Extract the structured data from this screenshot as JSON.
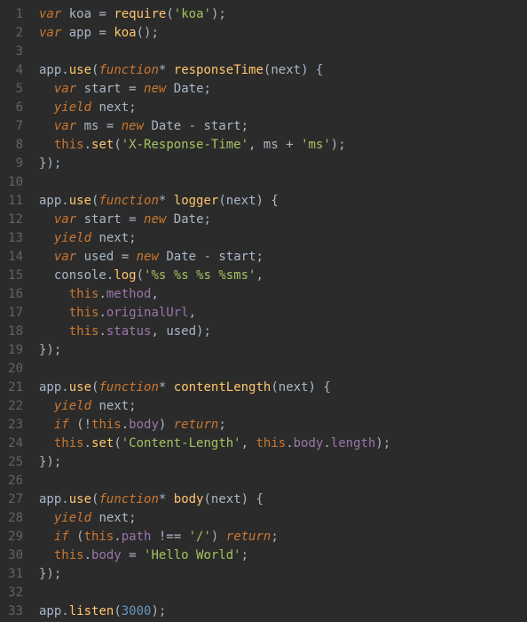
{
  "editor": {
    "language": "javascript",
    "theme": "darcula",
    "lines": [
      {
        "n": 1,
        "tokens": [
          [
            "kw",
            "var"
          ],
          [
            "op",
            " "
          ],
          [
            "id",
            "koa"
          ],
          [
            "op",
            " = "
          ],
          [
            "fn",
            "require"
          ],
          [
            "op",
            "("
          ],
          [
            "str",
            "'koa'"
          ],
          [
            "op",
            ");"
          ]
        ]
      },
      {
        "n": 2,
        "tokens": [
          [
            "kw",
            "var"
          ],
          [
            "op",
            " "
          ],
          [
            "id",
            "app"
          ],
          [
            "op",
            " = "
          ],
          [
            "fn",
            "koa"
          ],
          [
            "op",
            "();"
          ]
        ]
      },
      {
        "n": 3,
        "tokens": []
      },
      {
        "n": 4,
        "tokens": [
          [
            "id",
            "app"
          ],
          [
            "op",
            "."
          ],
          [
            "fn",
            "use"
          ],
          [
            "op",
            "("
          ],
          [
            "kw",
            "function"
          ],
          [
            "op",
            "* "
          ],
          [
            "name",
            "responseTime"
          ],
          [
            "op",
            "("
          ],
          [
            "param",
            "next"
          ],
          [
            "op",
            ") {"
          ]
        ]
      },
      {
        "n": 5,
        "tokens": [
          [
            "op",
            "  "
          ],
          [
            "kw",
            "var"
          ],
          [
            "op",
            " "
          ],
          [
            "id",
            "start"
          ],
          [
            "op",
            " = "
          ],
          [
            "kw",
            "new"
          ],
          [
            "op",
            " "
          ],
          [
            "type",
            "Date"
          ],
          [
            "op",
            ";"
          ]
        ]
      },
      {
        "n": 6,
        "tokens": [
          [
            "op",
            "  "
          ],
          [
            "kw",
            "yield"
          ],
          [
            "op",
            " "
          ],
          [
            "id",
            "next"
          ],
          [
            "op",
            ";"
          ]
        ]
      },
      {
        "n": 7,
        "tokens": [
          [
            "op",
            "  "
          ],
          [
            "kw",
            "var"
          ],
          [
            "op",
            " "
          ],
          [
            "id",
            "ms"
          ],
          [
            "op",
            " = "
          ],
          [
            "kw",
            "new"
          ],
          [
            "op",
            " "
          ],
          [
            "type",
            "Date"
          ],
          [
            "op",
            " - "
          ],
          [
            "id",
            "start"
          ],
          [
            "op",
            ";"
          ]
        ]
      },
      {
        "n": 8,
        "tokens": [
          [
            "op",
            "  "
          ],
          [
            "this",
            "this"
          ],
          [
            "op",
            "."
          ],
          [
            "fn",
            "set"
          ],
          [
            "op",
            "("
          ],
          [
            "str",
            "'X-Response-Time'"
          ],
          [
            "op",
            ", "
          ],
          [
            "id",
            "ms"
          ],
          [
            "op",
            " + "
          ],
          [
            "str",
            "'ms'"
          ],
          [
            "op",
            ");"
          ]
        ]
      },
      {
        "n": 9,
        "tokens": [
          [
            "op",
            "});"
          ]
        ]
      },
      {
        "n": 10,
        "tokens": []
      },
      {
        "n": 11,
        "tokens": [
          [
            "id",
            "app"
          ],
          [
            "op",
            "."
          ],
          [
            "fn",
            "use"
          ],
          [
            "op",
            "("
          ],
          [
            "kw",
            "function"
          ],
          [
            "op",
            "* "
          ],
          [
            "name",
            "logger"
          ],
          [
            "op",
            "("
          ],
          [
            "param",
            "next"
          ],
          [
            "op",
            ") {"
          ]
        ]
      },
      {
        "n": 12,
        "tokens": [
          [
            "op",
            "  "
          ],
          [
            "kw",
            "var"
          ],
          [
            "op",
            " "
          ],
          [
            "id",
            "start"
          ],
          [
            "op",
            " = "
          ],
          [
            "kw",
            "new"
          ],
          [
            "op",
            " "
          ],
          [
            "type",
            "Date"
          ],
          [
            "op",
            ";"
          ]
        ]
      },
      {
        "n": 13,
        "tokens": [
          [
            "op",
            "  "
          ],
          [
            "kw",
            "yield"
          ],
          [
            "op",
            " "
          ],
          [
            "id",
            "next"
          ],
          [
            "op",
            ";"
          ]
        ]
      },
      {
        "n": 14,
        "tokens": [
          [
            "op",
            "  "
          ],
          [
            "kw",
            "var"
          ],
          [
            "op",
            " "
          ],
          [
            "id",
            "used"
          ],
          [
            "op",
            " = "
          ],
          [
            "kw",
            "new"
          ],
          [
            "op",
            " "
          ],
          [
            "type",
            "Date"
          ],
          [
            "op",
            " - "
          ],
          [
            "id",
            "start"
          ],
          [
            "op",
            ";"
          ]
        ]
      },
      {
        "n": 15,
        "tokens": [
          [
            "op",
            "  "
          ],
          [
            "id",
            "console"
          ],
          [
            "op",
            "."
          ],
          [
            "fn",
            "log"
          ],
          [
            "op",
            "("
          ],
          [
            "str",
            "'%s %s %s %sms'"
          ],
          [
            "op",
            ","
          ]
        ]
      },
      {
        "n": 16,
        "tokens": [
          [
            "op",
            "    "
          ],
          [
            "this",
            "this"
          ],
          [
            "op",
            "."
          ],
          [
            "prop",
            "method"
          ],
          [
            "op",
            ","
          ]
        ]
      },
      {
        "n": 17,
        "tokens": [
          [
            "op",
            "    "
          ],
          [
            "this",
            "this"
          ],
          [
            "op",
            "."
          ],
          [
            "prop",
            "originalUrl"
          ],
          [
            "op",
            ","
          ]
        ]
      },
      {
        "n": 18,
        "tokens": [
          [
            "op",
            "    "
          ],
          [
            "this",
            "this"
          ],
          [
            "op",
            "."
          ],
          [
            "prop",
            "status"
          ],
          [
            "op",
            ", "
          ],
          [
            "id",
            "used"
          ],
          [
            "op",
            ");"
          ]
        ]
      },
      {
        "n": 19,
        "tokens": [
          [
            "op",
            "});"
          ]
        ]
      },
      {
        "n": 20,
        "tokens": []
      },
      {
        "n": 21,
        "tokens": [
          [
            "id",
            "app"
          ],
          [
            "op",
            "."
          ],
          [
            "fn",
            "use"
          ],
          [
            "op",
            "("
          ],
          [
            "kw",
            "function"
          ],
          [
            "op",
            "* "
          ],
          [
            "name",
            "contentLength"
          ],
          [
            "op",
            "("
          ],
          [
            "param",
            "next"
          ],
          [
            "op",
            ") {"
          ]
        ]
      },
      {
        "n": 22,
        "tokens": [
          [
            "op",
            "  "
          ],
          [
            "kw",
            "yield"
          ],
          [
            "op",
            " "
          ],
          [
            "id",
            "next"
          ],
          [
            "op",
            ";"
          ]
        ]
      },
      {
        "n": 23,
        "tokens": [
          [
            "op",
            "  "
          ],
          [
            "kw",
            "if"
          ],
          [
            "op",
            " (!"
          ],
          [
            "this",
            "this"
          ],
          [
            "op",
            "."
          ],
          [
            "prop",
            "body"
          ],
          [
            "op",
            ") "
          ],
          [
            "kw",
            "return"
          ],
          [
            "op",
            ";"
          ]
        ]
      },
      {
        "n": 24,
        "tokens": [
          [
            "op",
            "  "
          ],
          [
            "this",
            "this"
          ],
          [
            "op",
            "."
          ],
          [
            "fn",
            "set"
          ],
          [
            "op",
            "("
          ],
          [
            "str",
            "'Content-Length'"
          ],
          [
            "op",
            ", "
          ],
          [
            "this",
            "this"
          ],
          [
            "op",
            "."
          ],
          [
            "prop",
            "body"
          ],
          [
            "op",
            "."
          ],
          [
            "prop",
            "length"
          ],
          [
            "op",
            ");"
          ]
        ]
      },
      {
        "n": 25,
        "tokens": [
          [
            "op",
            "});"
          ]
        ]
      },
      {
        "n": 26,
        "tokens": []
      },
      {
        "n": 27,
        "tokens": [
          [
            "id",
            "app"
          ],
          [
            "op",
            "."
          ],
          [
            "fn",
            "use"
          ],
          [
            "op",
            "("
          ],
          [
            "kw",
            "function"
          ],
          [
            "op",
            "* "
          ],
          [
            "name",
            "body"
          ],
          [
            "op",
            "("
          ],
          [
            "param",
            "next"
          ],
          [
            "op",
            ") {"
          ]
        ]
      },
      {
        "n": 28,
        "tokens": [
          [
            "op",
            "  "
          ],
          [
            "kw",
            "yield"
          ],
          [
            "op",
            " "
          ],
          [
            "id",
            "next"
          ],
          [
            "op",
            ";"
          ]
        ]
      },
      {
        "n": 29,
        "tokens": [
          [
            "op",
            "  "
          ],
          [
            "kw",
            "if"
          ],
          [
            "op",
            " ("
          ],
          [
            "this",
            "this"
          ],
          [
            "op",
            "."
          ],
          [
            "prop",
            "path"
          ],
          [
            "op",
            " !== "
          ],
          [
            "str",
            "'/'"
          ],
          [
            "op",
            ") "
          ],
          [
            "kw",
            "return"
          ],
          [
            "op",
            ";"
          ]
        ]
      },
      {
        "n": 30,
        "tokens": [
          [
            "op",
            "  "
          ],
          [
            "this",
            "this"
          ],
          [
            "op",
            "."
          ],
          [
            "prop",
            "body"
          ],
          [
            "op",
            " = "
          ],
          [
            "str",
            "'Hello World'"
          ],
          [
            "op",
            ";"
          ]
        ]
      },
      {
        "n": 31,
        "tokens": [
          [
            "op",
            "});"
          ]
        ]
      },
      {
        "n": 32,
        "tokens": []
      },
      {
        "n": 33,
        "tokens": [
          [
            "id",
            "app"
          ],
          [
            "op",
            "."
          ],
          [
            "fn",
            "listen"
          ],
          [
            "op",
            "("
          ],
          [
            "num",
            "3000"
          ],
          [
            "op",
            ");"
          ]
        ]
      }
    ]
  }
}
